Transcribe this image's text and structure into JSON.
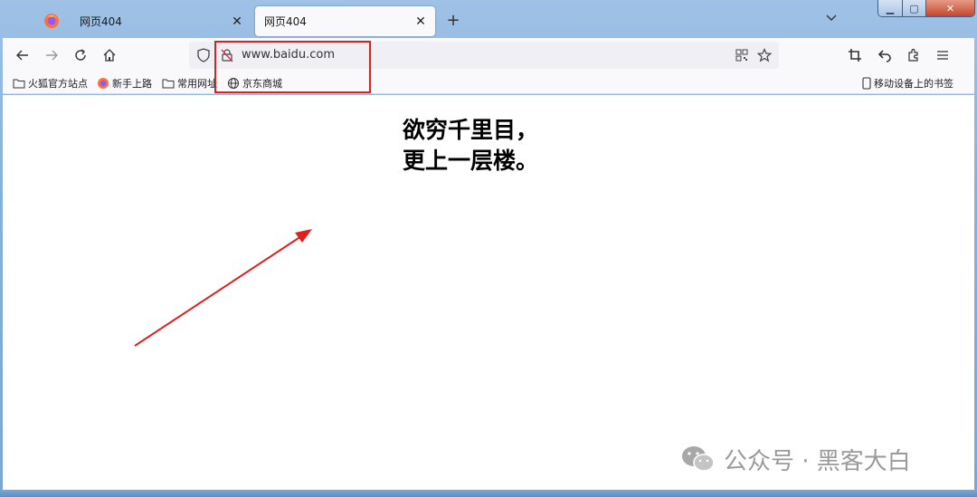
{
  "tabs": [
    {
      "title": "网页404",
      "close": "✕"
    },
    {
      "title": "网页404",
      "close": "✕"
    }
  ],
  "new_tab_label": "+",
  "tab_list_label": "⌄",
  "window_controls": {
    "minimize": "▁",
    "maximize": "▢",
    "close": "✕"
  },
  "toolbar": {
    "url": "www.baidu.com"
  },
  "bookmarks": [
    {
      "icon": "folder-icon",
      "label": "火狐官方站点"
    },
    {
      "icon": "firefox-icon",
      "label": "新手上路"
    },
    {
      "icon": "folder-icon",
      "label": "常用网址"
    },
    {
      "icon": "globe-icon",
      "label": "京东商城"
    }
  ],
  "mobile_bookmarks": "移动设备上的书签",
  "content": {
    "line1": "欲穷千里目，",
    "line2": "更上一层楼。"
  },
  "watermark": "公众号 · 黑客大白",
  "colors": {
    "annotation_red": "#e0201d",
    "toolbar_bg": "#f9f9fb",
    "urlbar_bg": "#f0f0f4"
  }
}
